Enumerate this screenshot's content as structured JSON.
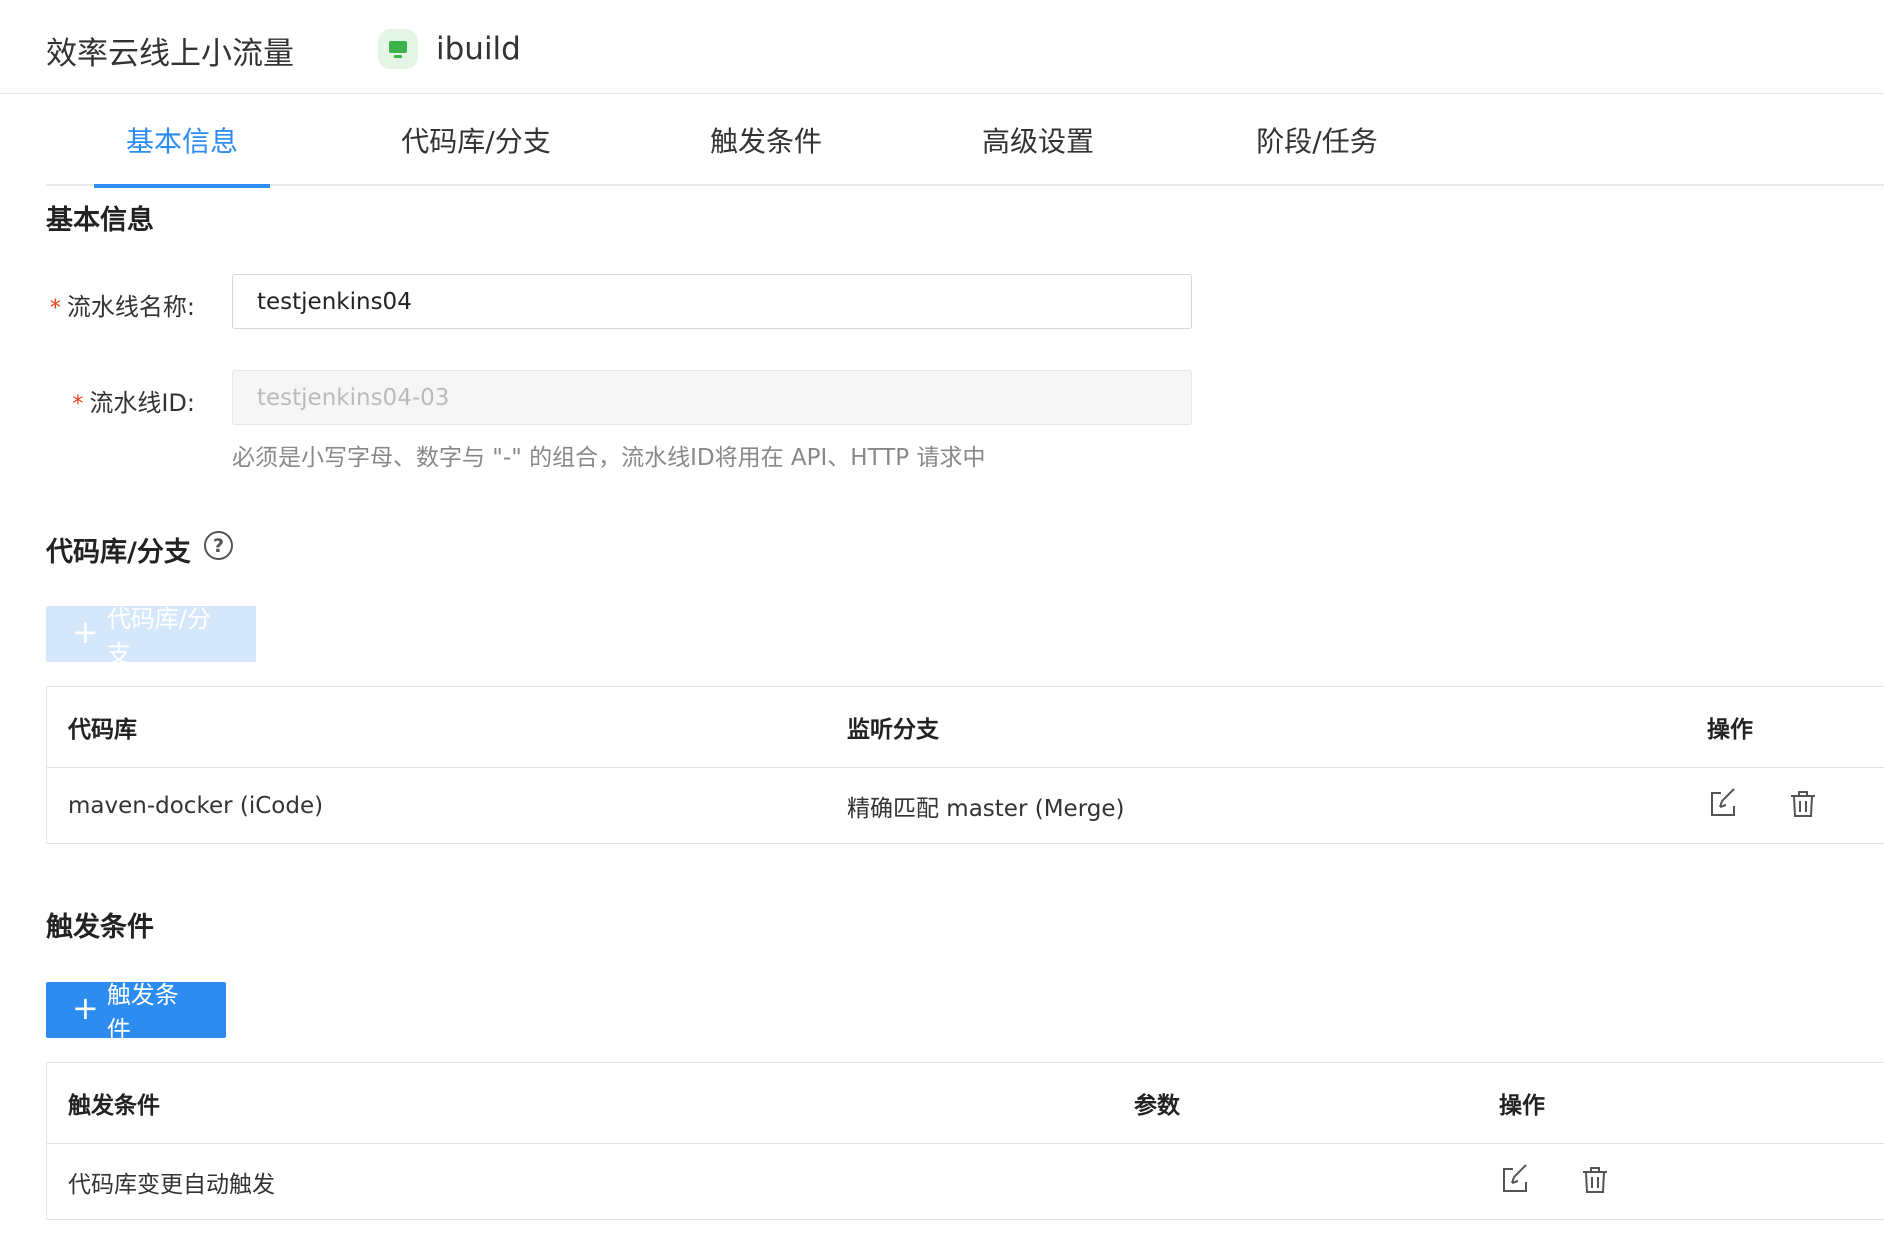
{
  "header": {
    "app_title": "效率云线上小流量",
    "pipeline_icon": "monitor-icon",
    "pipeline_name": "ibuild"
  },
  "tabs": [
    {
      "label": "基本信息",
      "active": true
    },
    {
      "label": "代码库/分支",
      "active": false
    },
    {
      "label": "触发条件",
      "active": false
    },
    {
      "label": "高级设置",
      "active": false
    },
    {
      "label": "阶段/任务",
      "active": false
    }
  ],
  "basic_info": {
    "title": "基本信息",
    "name_label": "流水线名称:",
    "name_value": "testjenkins04",
    "id_label": "流水线ID:",
    "id_placeholder": "testjenkins04-03",
    "id_hint": "必须是小写字母、数字与 \"-\" 的组合，流水线ID将用在 API、HTTP 请求中",
    "required_mark": "*"
  },
  "repo_section": {
    "title": "代码库/分支",
    "help_icon": "question-circle-icon",
    "help_glyph": "?",
    "add_button": "代码库/分支",
    "add_enabled": false,
    "columns": [
      "代码库",
      "监听分支",
      "操作"
    ],
    "rows": [
      {
        "repo": "maven-docker (iCode)",
        "branch": "精确匹配 master (Merge)"
      }
    ]
  },
  "trigger_section": {
    "title": "触发条件",
    "add_button": "触发条件",
    "add_enabled": true,
    "columns": [
      "触发条件",
      "参数",
      "操作"
    ],
    "rows": [
      {
        "condition": "代码库变更自动触发",
        "params": ""
      }
    ]
  },
  "icons": {
    "plus": "+",
    "edit": "edit-icon",
    "delete": "trash-icon"
  },
  "colors": {
    "primary": "#2d8cf0",
    "primary_disabled": "#d5e8fb",
    "required": "#ed4014",
    "pipeline_badge": "#3cb34a"
  }
}
